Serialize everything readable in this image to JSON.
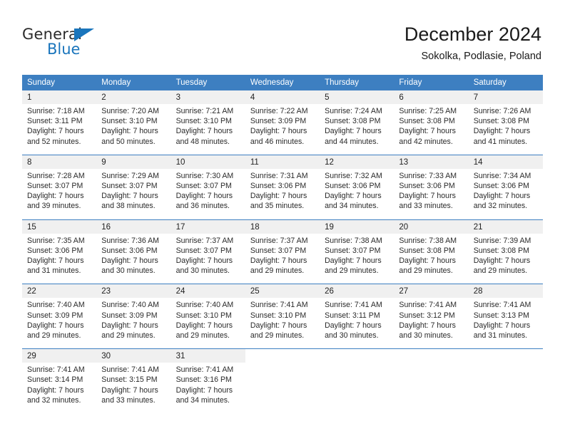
{
  "brand": {
    "name_part1": "General",
    "name_part2": "Blue",
    "triangle_color": "#1a75bc",
    "text_color": "#2b2b2b"
  },
  "header": {
    "title": "December 2024",
    "subtitle": "Sokolka, Podlasie, Poland"
  },
  "colors": {
    "header_row": "#3d7fc1",
    "daynum_bg": "#f0f0f0",
    "cell_bg": "#ffffff",
    "text": "#2a2a2a"
  },
  "weekdays": [
    "Sunday",
    "Monday",
    "Tuesday",
    "Wednesday",
    "Thursday",
    "Friday",
    "Saturday"
  ],
  "weeks": [
    {
      "days": [
        {
          "num": "1",
          "sunrise": "Sunrise: 7:18 AM",
          "sunset": "Sunset: 3:11 PM",
          "daylight1": "Daylight: 7 hours",
          "daylight2": "and 52 minutes."
        },
        {
          "num": "2",
          "sunrise": "Sunrise: 7:20 AM",
          "sunset": "Sunset: 3:10 PM",
          "daylight1": "Daylight: 7 hours",
          "daylight2": "and 50 minutes."
        },
        {
          "num": "3",
          "sunrise": "Sunrise: 7:21 AM",
          "sunset": "Sunset: 3:10 PM",
          "daylight1": "Daylight: 7 hours",
          "daylight2": "and 48 minutes."
        },
        {
          "num": "4",
          "sunrise": "Sunrise: 7:22 AM",
          "sunset": "Sunset: 3:09 PM",
          "daylight1": "Daylight: 7 hours",
          "daylight2": "and 46 minutes."
        },
        {
          "num": "5",
          "sunrise": "Sunrise: 7:24 AM",
          "sunset": "Sunset: 3:08 PM",
          "daylight1": "Daylight: 7 hours",
          "daylight2": "and 44 minutes."
        },
        {
          "num": "6",
          "sunrise": "Sunrise: 7:25 AM",
          "sunset": "Sunset: 3:08 PM",
          "daylight1": "Daylight: 7 hours",
          "daylight2": "and 42 minutes."
        },
        {
          "num": "7",
          "sunrise": "Sunrise: 7:26 AM",
          "sunset": "Sunset: 3:08 PM",
          "daylight1": "Daylight: 7 hours",
          "daylight2": "and 41 minutes."
        }
      ]
    },
    {
      "days": [
        {
          "num": "8",
          "sunrise": "Sunrise: 7:28 AM",
          "sunset": "Sunset: 3:07 PM",
          "daylight1": "Daylight: 7 hours",
          "daylight2": "and 39 minutes."
        },
        {
          "num": "9",
          "sunrise": "Sunrise: 7:29 AM",
          "sunset": "Sunset: 3:07 PM",
          "daylight1": "Daylight: 7 hours",
          "daylight2": "and 38 minutes."
        },
        {
          "num": "10",
          "sunrise": "Sunrise: 7:30 AM",
          "sunset": "Sunset: 3:07 PM",
          "daylight1": "Daylight: 7 hours",
          "daylight2": "and 36 minutes."
        },
        {
          "num": "11",
          "sunrise": "Sunrise: 7:31 AM",
          "sunset": "Sunset: 3:06 PM",
          "daylight1": "Daylight: 7 hours",
          "daylight2": "and 35 minutes."
        },
        {
          "num": "12",
          "sunrise": "Sunrise: 7:32 AM",
          "sunset": "Sunset: 3:06 PM",
          "daylight1": "Daylight: 7 hours",
          "daylight2": "and 34 minutes."
        },
        {
          "num": "13",
          "sunrise": "Sunrise: 7:33 AM",
          "sunset": "Sunset: 3:06 PM",
          "daylight1": "Daylight: 7 hours",
          "daylight2": "and 33 minutes."
        },
        {
          "num": "14",
          "sunrise": "Sunrise: 7:34 AM",
          "sunset": "Sunset: 3:06 PM",
          "daylight1": "Daylight: 7 hours",
          "daylight2": "and 32 minutes."
        }
      ]
    },
    {
      "days": [
        {
          "num": "15",
          "sunrise": "Sunrise: 7:35 AM",
          "sunset": "Sunset: 3:06 PM",
          "daylight1": "Daylight: 7 hours",
          "daylight2": "and 31 minutes."
        },
        {
          "num": "16",
          "sunrise": "Sunrise: 7:36 AM",
          "sunset": "Sunset: 3:06 PM",
          "daylight1": "Daylight: 7 hours",
          "daylight2": "and 30 minutes."
        },
        {
          "num": "17",
          "sunrise": "Sunrise: 7:37 AM",
          "sunset": "Sunset: 3:07 PM",
          "daylight1": "Daylight: 7 hours",
          "daylight2": "and 30 minutes."
        },
        {
          "num": "18",
          "sunrise": "Sunrise: 7:37 AM",
          "sunset": "Sunset: 3:07 PM",
          "daylight1": "Daylight: 7 hours",
          "daylight2": "and 29 minutes."
        },
        {
          "num": "19",
          "sunrise": "Sunrise: 7:38 AM",
          "sunset": "Sunset: 3:07 PM",
          "daylight1": "Daylight: 7 hours",
          "daylight2": "and 29 minutes."
        },
        {
          "num": "20",
          "sunrise": "Sunrise: 7:38 AM",
          "sunset": "Sunset: 3:08 PM",
          "daylight1": "Daylight: 7 hours",
          "daylight2": "and 29 minutes."
        },
        {
          "num": "21",
          "sunrise": "Sunrise: 7:39 AM",
          "sunset": "Sunset: 3:08 PM",
          "daylight1": "Daylight: 7 hours",
          "daylight2": "and 29 minutes."
        }
      ]
    },
    {
      "days": [
        {
          "num": "22",
          "sunrise": "Sunrise: 7:40 AM",
          "sunset": "Sunset: 3:09 PM",
          "daylight1": "Daylight: 7 hours",
          "daylight2": "and 29 minutes."
        },
        {
          "num": "23",
          "sunrise": "Sunrise: 7:40 AM",
          "sunset": "Sunset: 3:09 PM",
          "daylight1": "Daylight: 7 hours",
          "daylight2": "and 29 minutes."
        },
        {
          "num": "24",
          "sunrise": "Sunrise: 7:40 AM",
          "sunset": "Sunset: 3:10 PM",
          "daylight1": "Daylight: 7 hours",
          "daylight2": "and 29 minutes."
        },
        {
          "num": "25",
          "sunrise": "Sunrise: 7:41 AM",
          "sunset": "Sunset: 3:10 PM",
          "daylight1": "Daylight: 7 hours",
          "daylight2": "and 29 minutes."
        },
        {
          "num": "26",
          "sunrise": "Sunrise: 7:41 AM",
          "sunset": "Sunset: 3:11 PM",
          "daylight1": "Daylight: 7 hours",
          "daylight2": "and 30 minutes."
        },
        {
          "num": "27",
          "sunrise": "Sunrise: 7:41 AM",
          "sunset": "Sunset: 3:12 PM",
          "daylight1": "Daylight: 7 hours",
          "daylight2": "and 30 minutes."
        },
        {
          "num": "28",
          "sunrise": "Sunrise: 7:41 AM",
          "sunset": "Sunset: 3:13 PM",
          "daylight1": "Daylight: 7 hours",
          "daylight2": "and 31 minutes."
        }
      ]
    },
    {
      "days": [
        {
          "num": "29",
          "sunrise": "Sunrise: 7:41 AM",
          "sunset": "Sunset: 3:14 PM",
          "daylight1": "Daylight: 7 hours",
          "daylight2": "and 32 minutes."
        },
        {
          "num": "30",
          "sunrise": "Sunrise: 7:41 AM",
          "sunset": "Sunset: 3:15 PM",
          "daylight1": "Daylight: 7 hours",
          "daylight2": "and 33 minutes."
        },
        {
          "num": "31",
          "sunrise": "Sunrise: 7:41 AM",
          "sunset": "Sunset: 3:16 PM",
          "daylight1": "Daylight: 7 hours",
          "daylight2": "and 34 minutes."
        },
        {
          "num": "",
          "sunrise": "",
          "sunset": "",
          "daylight1": "",
          "daylight2": ""
        },
        {
          "num": "",
          "sunrise": "",
          "sunset": "",
          "daylight1": "",
          "daylight2": ""
        },
        {
          "num": "",
          "sunrise": "",
          "sunset": "",
          "daylight1": "",
          "daylight2": ""
        },
        {
          "num": "",
          "sunrise": "",
          "sunset": "",
          "daylight1": "",
          "daylight2": ""
        }
      ]
    }
  ]
}
